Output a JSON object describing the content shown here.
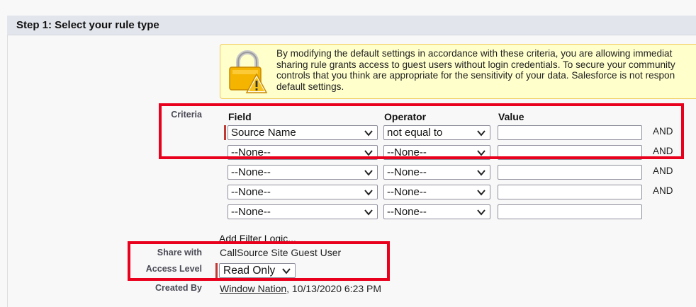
{
  "step_header": {
    "title": "Step 1: Select your rule type"
  },
  "warning": {
    "lines": [
      "By modifying the default settings in accordance with these criteria, you are allowing immediat",
      "sharing rule grants access to guest users without login credentials. To secure your community",
      "controls that you think are appropriate for the sensitivity of your data. Salesforce is not respon",
      "default settings."
    ],
    "icon": "lock-warning-icon"
  },
  "criteria": {
    "label": "Criteria",
    "columns": {
      "field": "Field",
      "operator": "Operator",
      "value": "Value"
    },
    "rows": [
      {
        "field": "Source Name",
        "operator": "not equal to",
        "value": "",
        "conjunction": "AND"
      },
      {
        "field": "--None--",
        "operator": "--None--",
        "value": "",
        "conjunction": "AND"
      },
      {
        "field": "--None--",
        "operator": "--None--",
        "value": "",
        "conjunction": "AND"
      },
      {
        "field": "--None--",
        "operator": "--None--",
        "value": "",
        "conjunction": "AND"
      },
      {
        "field": "--None--",
        "operator": "--None--",
        "value": "",
        "conjunction": ""
      }
    ],
    "add_filter_logic": "Add Filter Logic..."
  },
  "share_with": {
    "label": "Share with",
    "value": "CallSource Site Guest User"
  },
  "access_level": {
    "label": "Access Level",
    "value": "Read Only"
  },
  "created_by": {
    "label": "Created By",
    "user": "Window Nation",
    "timestamp": ", 10/13/2020 6:23 PM"
  },
  "colors": {
    "highlight_box": "#e8001c",
    "required_bar": "#c23934",
    "warning_bg": "#ffffcc",
    "header_bg": "#e3e5ec"
  }
}
